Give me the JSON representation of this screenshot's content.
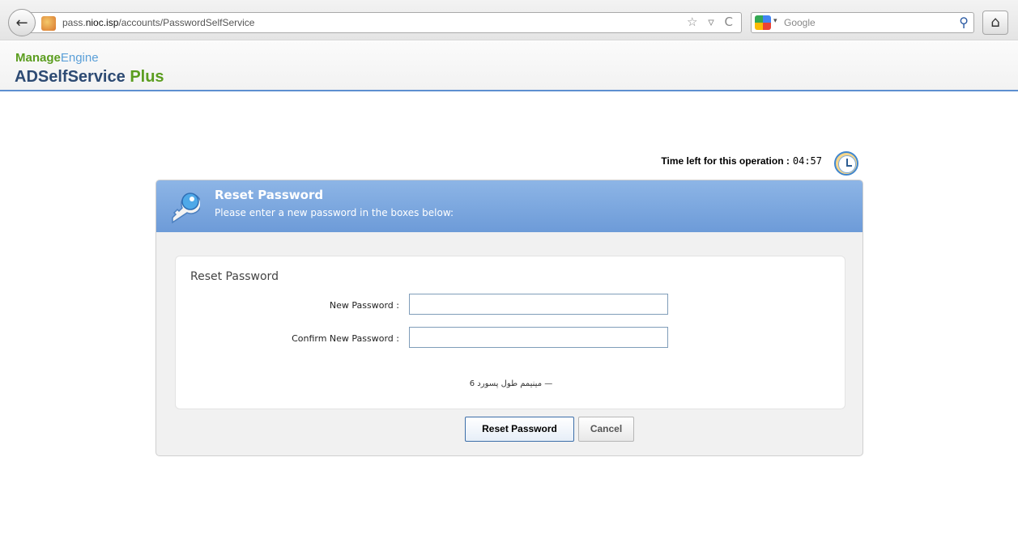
{
  "browser": {
    "url_prefix": "pass.",
    "url_host": "nioc.isp",
    "url_path": "/accounts/PasswordSelfService",
    "url_icons": "☆ ▿ C",
    "search_engine_placeholder": "Google"
  },
  "app": {
    "brand_manage": "Manage",
    "brand_engine": "Engine",
    "brand_product": "ADSelfService",
    "brand_plus": "Plus"
  },
  "timer": {
    "label": "Time left for this operation :",
    "value": "04:57"
  },
  "panel": {
    "header_title": "Reset Password",
    "header_subtitle": "Please enter a new password in the boxes below:",
    "form_title": "Reset Password",
    "fields": [
      {
        "label": "New Password :",
        "value": ""
      },
      {
        "label": "Confirm New Password :",
        "value": ""
      }
    ],
    "hint": "مینیمم طول پسورد  6   —",
    "reset_button": "Reset Password",
    "cancel_button": "Cancel"
  },
  "colors": {
    "header_blue": "#6d9bd8",
    "brand_green": "#5b9d1f",
    "brand_navy": "#2d4a73",
    "divider_blue": "#5d8fd0"
  }
}
